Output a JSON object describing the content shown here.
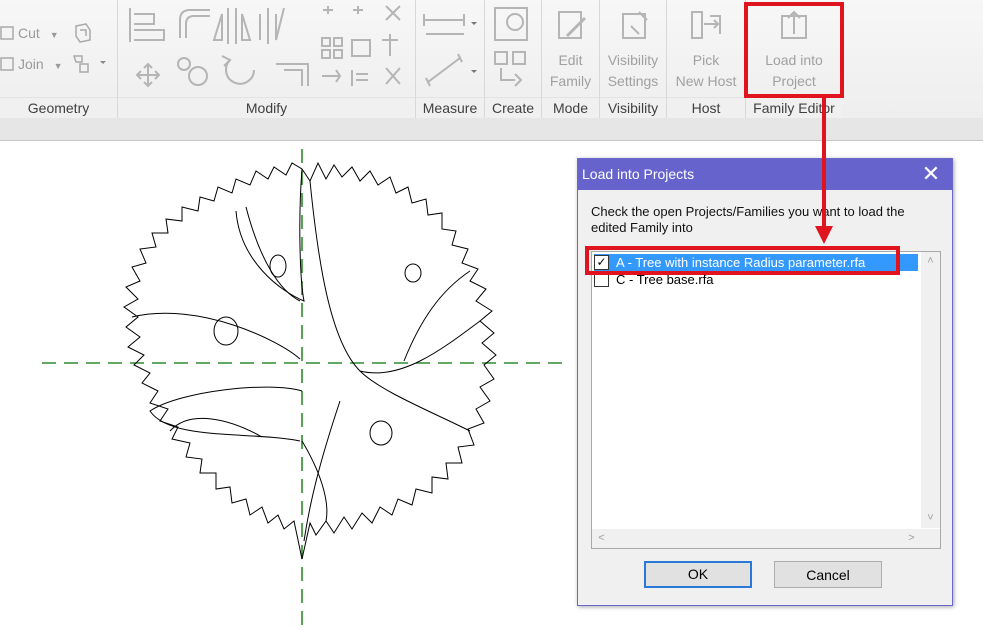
{
  "ribbon": {
    "geometry": {
      "cut_label": "Cut",
      "join_label": "Join",
      "panel_label": "Geometry"
    },
    "modify": {
      "panel_label": "Modify"
    },
    "measure": {
      "panel_label": "Measure"
    },
    "create": {
      "panel_label": "Create"
    },
    "mode": {
      "edit_family_line1": "Edit",
      "edit_family_line2": "Family",
      "panel_label": "Mode"
    },
    "visibility": {
      "line1": "Visibility",
      "line2": "Settings",
      "panel_label": "Visibility"
    },
    "host": {
      "line1": "Pick",
      "line2": "New Host",
      "panel_label": "Host"
    },
    "family_editor": {
      "line1": "Load into",
      "line2": "Project",
      "panel_label": "Family Editor"
    }
  },
  "dialog": {
    "title": "Load into Projects",
    "close_glyph": "✕",
    "instruction": "Check the open Projects/Families you want to load the edited Family into",
    "items": [
      {
        "label": "A - Tree with instance Radius parameter.rfa",
        "checked": true,
        "check_glyph": "✓"
      },
      {
        "label": "C - Tree base.rfa",
        "checked": false
      }
    ],
    "scroll_up": "˄",
    "scroll_down": "˅",
    "scroll_left": "˂",
    "scroll_right": "˃",
    "ok_label": "OK",
    "cancel_label": "Cancel"
  },
  "colors": {
    "annotation_red": "#e0141e",
    "dialog_title_bg": "#6664cc",
    "selection": "#3399ff",
    "reference_plane": "#2e8b2e"
  }
}
